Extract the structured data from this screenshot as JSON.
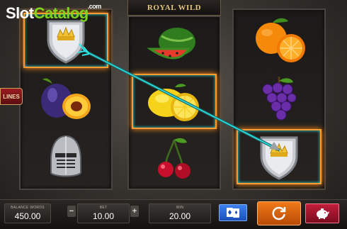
{
  "watermark": {
    "part1": "Slot",
    "part2": "Catalog",
    "suffix": ".com"
  },
  "game": {
    "title": "ROYAL WILD"
  },
  "paylines_tab": {
    "label": "LINES"
  },
  "reels": [
    [
      "shield-crown",
      "plum",
      "knight-helmet"
    ],
    [
      "watermelon",
      "lemon",
      "cherries"
    ],
    [
      "orange",
      "grapes",
      "shield-crown"
    ]
  ],
  "winning_symbols": [
    "reel1-row1",
    "reel2-row2",
    "reel3-row3"
  ],
  "controls": {
    "balance_label": "BALANCE WORDS",
    "balance_value": "450.00",
    "bet_label": "BET",
    "bet_value": "10.00",
    "bet_minus": "−",
    "bet_plus": "+",
    "win_label": "WIN",
    "win_value": "20.00"
  },
  "colors": {
    "highlight": "#ff9b2f",
    "arrow": "#2ee6e6",
    "spin": "#f07a1a",
    "gamble": "#3b82f0",
    "bank": "#c21d3a"
  }
}
